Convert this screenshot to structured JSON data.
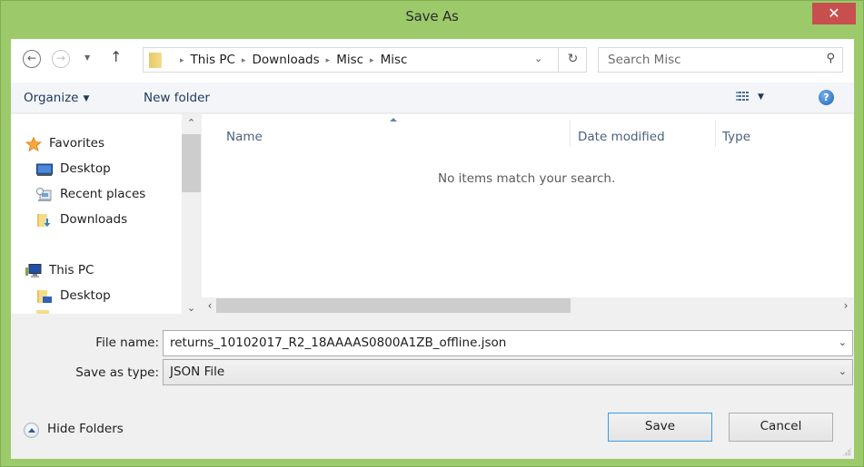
{
  "window": {
    "title": "Save As",
    "close_glyph": "✕",
    "accent_color": "#9cca6b",
    "close_color": "#c7504f"
  },
  "navigation": {
    "back_glyph": "←",
    "forward_glyph": "→",
    "recent_glyph": "▼",
    "up_glyph": "↑"
  },
  "address_bar": {
    "breadcrumbs": [
      "This PC",
      "Downloads",
      "Misc",
      "Misc"
    ],
    "separator_glyph": "▸",
    "dropdown_glyph": "⌄",
    "refresh_glyph": "↻"
  },
  "search": {
    "placeholder": "Search Misc",
    "icon_glyph": "⚲"
  },
  "toolbar": {
    "organize_label": "Organize",
    "organize_caret": "▼",
    "new_folder_label": "New folder",
    "views_caret": "▼",
    "help_glyph": "?"
  },
  "nav_pane": {
    "groups": [
      {
        "label": "Favorites",
        "icon": "star-icon",
        "items": [
          {
            "label": "Desktop",
            "icon": "desktop-icon"
          },
          {
            "label": "Recent places",
            "icon": "recent-places-icon"
          },
          {
            "label": "Downloads",
            "icon": "downloads-folder-icon"
          }
        ]
      },
      {
        "label": "This PC",
        "icon": "computer-icon",
        "items": [
          {
            "label": "Desktop",
            "icon": "desktop-folder-icon"
          }
        ]
      }
    ],
    "scroll_up_glyph": "⌃",
    "scroll_down_glyph": "⌄"
  },
  "file_list": {
    "columns": [
      "Name",
      "Date modified",
      "Type"
    ],
    "empty_message": "No items match your search.",
    "scroll_left_glyph": "‹",
    "scroll_right_glyph": "›"
  },
  "form": {
    "file_name_label": "File name:",
    "file_name_value": "returns_10102017_R2_18AAAAS0800A1ZB_offline.json",
    "save_type_label": "Save as type:",
    "save_type_value": "JSON File",
    "dropdown_glyph": "⌄"
  },
  "footer": {
    "hide_folders_label": "Hide Folders",
    "save_label": "Save",
    "cancel_label": "Cancel"
  }
}
